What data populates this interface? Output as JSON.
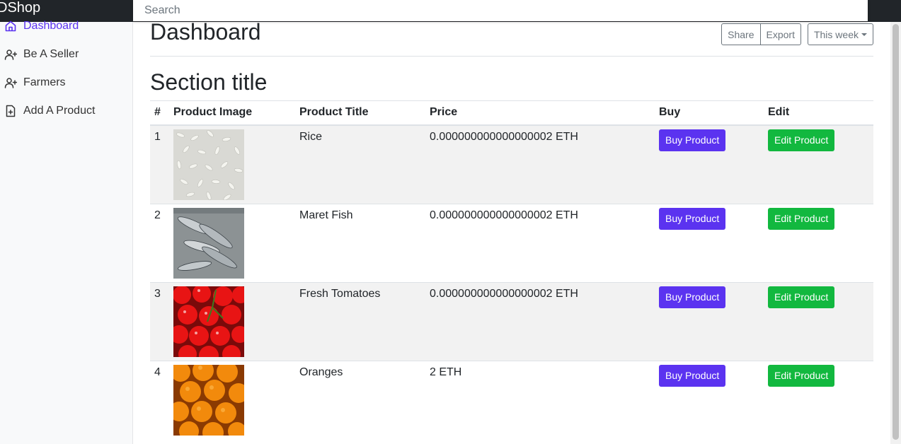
{
  "header": {
    "brand": "DShop",
    "search_placeholder": "Search"
  },
  "sidebar": {
    "items": [
      {
        "label": "Dashboard",
        "icon": "home-icon",
        "active": true
      },
      {
        "label": "Be A Seller",
        "icon": "user-plus-icon"
      },
      {
        "label": "Farmers",
        "icon": "user-plus-icon"
      },
      {
        "label": "Add A Product",
        "icon": "file-plus-icon"
      }
    ]
  },
  "main": {
    "title": "Dashboard",
    "toolbar": {
      "share": "Share",
      "export": "Export",
      "period": "This week"
    },
    "section_title": "Section title",
    "table": {
      "headers": [
        "#",
        "Product Image",
        "Product Title",
        "Price",
        "Buy",
        "Edit"
      ],
      "rows": [
        {
          "num": "1",
          "image": "rice",
          "title": "Rice",
          "price": "0.000000000000000002 ETH",
          "buy": "Buy Product",
          "edit": "Edit Product"
        },
        {
          "num": "2",
          "image": "fish",
          "title": "Maret Fish",
          "price": "0.000000000000000002 ETH",
          "buy": "Buy Product",
          "edit": "Edit Product"
        },
        {
          "num": "3",
          "image": "tomatoes",
          "title": "Fresh Tomatoes",
          "price": "0.000000000000000002 ETH",
          "buy": "Buy Product",
          "edit": "Edit Product"
        },
        {
          "num": "4",
          "image": "oranges",
          "title": "Oranges",
          "price": "2 ETH",
          "buy": "Buy Product",
          "edit": "Edit Product"
        }
      ]
    }
  },
  "colors": {
    "accent": "#5b33f0",
    "success": "#12b83f",
    "topbar": "#212529"
  }
}
